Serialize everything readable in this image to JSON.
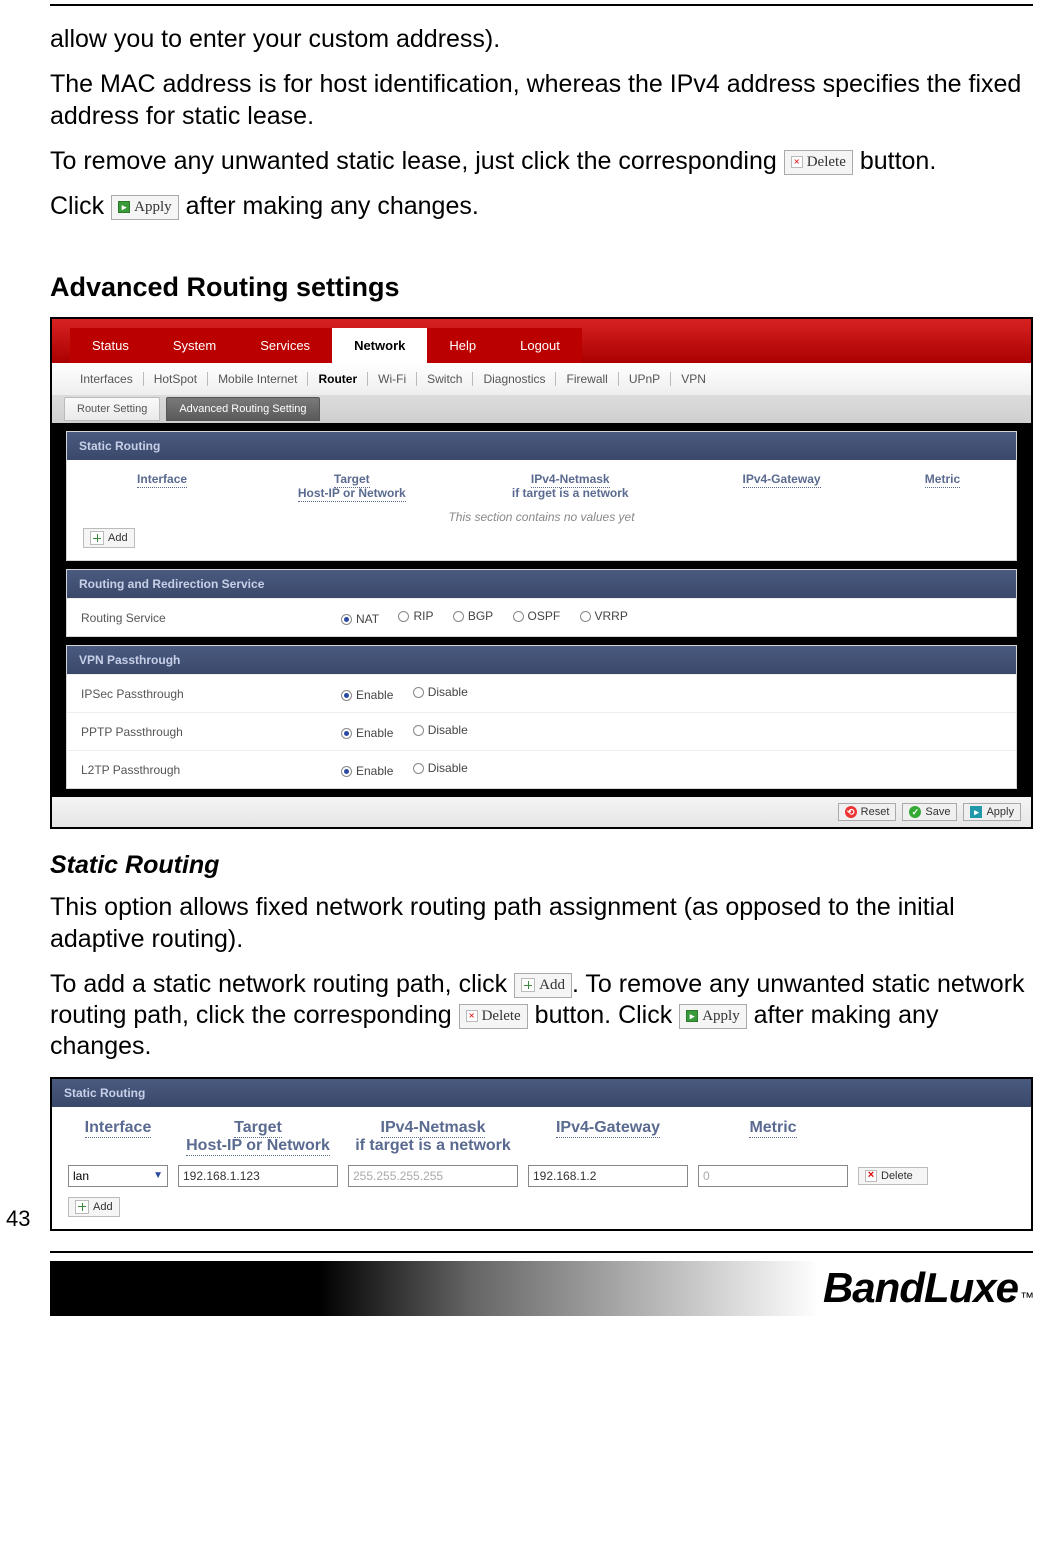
{
  "doc": {
    "p1": "allow you to enter your custom address).",
    "p2": "The MAC address is for host identification, whereas the IPv4 address specifies the fixed address for static lease.",
    "p3a": "To remove any unwanted static lease, just click the corresponding ",
    "p3b": " button.",
    "p4a": "Click ",
    "p4b": " after making any changes.",
    "h2": "Advanced Routing settings",
    "h3": "Static Routing",
    "p5": "This option allows fixed network routing path assignment (as opposed to the initial adaptive routing).",
    "p6a": "To add a static network routing path, click ",
    "p6b": ". To remove any unwanted static network routing path, click the corresponding ",
    "p6c": " button. Click ",
    "p6d": " after making any changes.",
    "page_number": "43",
    "brand": "BandLuxe",
    "tm": "™"
  },
  "buttons": {
    "delete": "Delete",
    "apply": "Apply",
    "add": "Add",
    "reset": "Reset",
    "save": "Save"
  },
  "ui": {
    "main_tabs": [
      "Status",
      "System",
      "Services",
      "Network",
      "Help",
      "Logout"
    ],
    "main_active": "Network",
    "sub_tabs": [
      "Interfaces",
      "HotSpot",
      "Mobile Internet",
      "Router",
      "Wi-Fi",
      "Switch",
      "Diagnostics",
      "Firewall",
      "UPnP",
      "VPN"
    ],
    "sub_active": "Router",
    "page_tabs": [
      "Router Setting",
      "Advanced Routing Setting"
    ],
    "page_active": "Advanced Routing Setting",
    "static_routing": {
      "title": "Static Routing",
      "cols": {
        "interface": "Interface",
        "target": "Target",
        "target_sub": "Host-IP or Network",
        "netmask": "IPv4-Netmask",
        "netmask_sub": "if target is a network",
        "gateway": "IPv4-Gateway",
        "metric": "Metric"
      },
      "empty": "This section contains no values yet"
    },
    "routing_service": {
      "title": "Routing and Redirection Service",
      "label": "Routing Service",
      "options": [
        "NAT",
        "RIP",
        "BGP",
        "OSPF",
        "VRRP"
      ],
      "selected": "NAT"
    },
    "vpn": {
      "title": "VPN Passthrough",
      "rows": [
        {
          "label": "IPSec Passthrough",
          "value": "Enable"
        },
        {
          "label": "PPTP Passthrough",
          "value": "Enable"
        },
        {
          "label": "L2TP Passthrough",
          "value": "Enable"
        }
      ],
      "enable": "Enable",
      "disable": "Disable"
    },
    "example_row": {
      "interface": "lan",
      "target": "192.168.1.123",
      "netmask": "255.255.255.255",
      "gateway": "192.168.1.2",
      "metric": "0"
    }
  }
}
